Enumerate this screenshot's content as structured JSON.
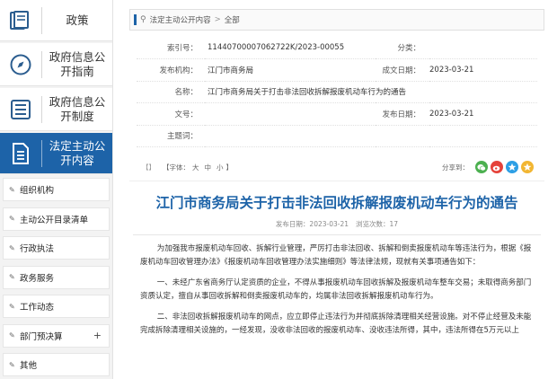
{
  "sidebar": {
    "nav": [
      {
        "label": "政策",
        "icon": "book-icon"
      },
      {
        "label": "政府信息公开指南",
        "icon": "compass-icon"
      },
      {
        "label": "政府信息公开制度",
        "icon": "list-icon"
      },
      {
        "label": "法定主动公开内容",
        "icon": "document-icon"
      }
    ],
    "items": [
      {
        "label": "组织机构"
      },
      {
        "label": "主动公开目录清单"
      },
      {
        "label": "行政执法"
      },
      {
        "label": "政务服务"
      },
      {
        "label": "工作动态"
      },
      {
        "label": "部门预决算",
        "plus": "+"
      },
      {
        "label": "其他"
      }
    ]
  },
  "breadcrumb": {
    "item1": "法定主动公开内容",
    "sep": ">",
    "item2": "全部"
  },
  "meta": {
    "index_label": "索引号：",
    "index_value": "11440700007062722K/2023-00055",
    "category_label": "分类：",
    "category_value": "",
    "publisher_label": "发布机构：",
    "publisher_value": "江门市商务局",
    "created_label": "成文日期：",
    "created_value": "2023-03-21",
    "name_label": "名称：",
    "name_value": "江门市商务局关于打击非法回收拆解报废机动车行为的通告",
    "docno_label": "文号：",
    "docno_value": "",
    "pubdate_label": "发布日期：",
    "pubdate_value": "2023-03-21",
    "subject_label": "主题词：",
    "subject_value": ""
  },
  "toolbar": {
    "open": "【",
    "close": "】",
    "font_label": "【字体：",
    "large": "大",
    "medium": "中",
    "small": "小",
    "font_close": "】",
    "share_label": "分享到："
  },
  "article": {
    "title": "江门市商务局关于打击非法回收拆解报废机动车行为的通告",
    "pub_time": "发布日期：2023-03-21",
    "views": "浏览次数：17",
    "p1": "为加强我市报废机动车回收、拆解行业管理，严厉打击非法回收、拆解和倒卖报废机动车等违法行为，根据《报废机动车回收管理办法》《报废机动车回收管理办法实施细则》等法律法规，现就有关事项通告如下：",
    "p2": "一、未经广东省商务厅认定资质的企业，不得从事报废机动车回收拆解及报废机动车整车交易；未取得商务部门资质认定，擅自从事回收拆解和倒卖报废机动车的，均属非法回收拆解报废机动车行为。",
    "p3": "二、非法回收拆解报废机动车的网点，应立即停止违法行为并彻底拆除清理相关经营设施。对不停止经营及未能完成拆除清理相关设施的，一经发现，没收非法回收的报废机动车、没收违法所得，其中，违法所得在5万元以上"
  },
  "colors": {
    "accent": "#1d63a8",
    "wechat": "#4cb050",
    "weibo": "#e5423a",
    "qzone": "#2d9fe5",
    "other": "#f2b632"
  }
}
